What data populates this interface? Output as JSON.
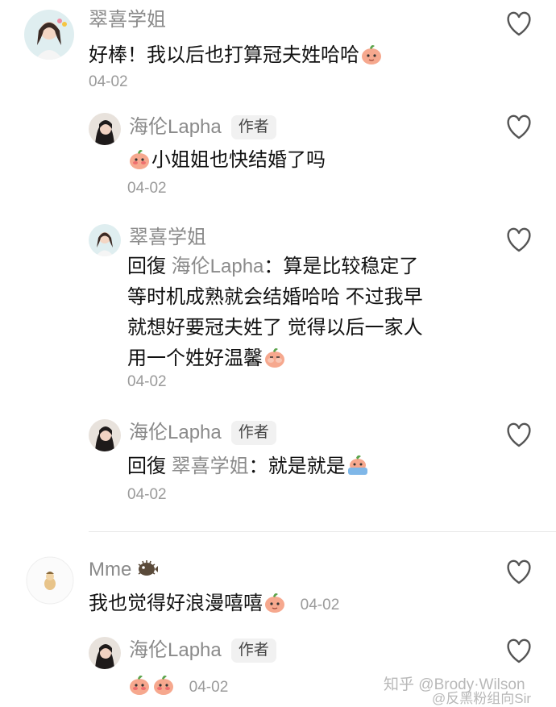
{
  "comments": [
    {
      "name": "翠喜学姐",
      "text": "好棒！我以后也打算冠夫姓哈哈",
      "date": "04-02"
    },
    {
      "name": "海伦Lapha",
      "badge": "作者",
      "text": "小姐姐也快结婚了吗",
      "date": "04-02"
    },
    {
      "name": "翠喜学姐",
      "reply_prefix": "回復",
      "reply_to": "海伦Lapha",
      "reply_sep": "：",
      "lines": [
        "算是比较稳定了",
        "等时机成熟就会结婚哈哈 不过我早",
        "就想好要冠夫姓了 觉得以后一家人",
        "用一个姓好温馨"
      ],
      "date": "04-02"
    },
    {
      "name": "海伦Lapha",
      "badge": "作者",
      "reply_prefix": "回復",
      "reply_to": "翠喜学姐",
      "reply_sep": "：",
      "text": "就是就是",
      "date": "04-02"
    },
    {
      "name": "Mme",
      "text": "我也觉得好浪漫嘻嘻",
      "date": "04-02"
    },
    {
      "name": "海伦Lapha",
      "badge": "作者",
      "date": "04-02"
    }
  ],
  "watermark": {
    "line1": "知乎 @Brody·Wilson",
    "line2": "@反黑粉组向Sir"
  },
  "colors": {
    "meta": "#8a8a8a",
    "text": "#111111",
    "peach": "#f6a88e",
    "leaf": "#5aa34a"
  }
}
